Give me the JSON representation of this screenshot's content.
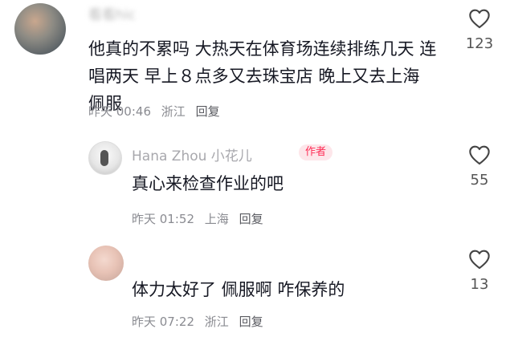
{
  "comments": [
    {
      "username": "看看hic",
      "text": "他真的不累吗 大热天在体育场连续排练几天 连唱两天 早上８点多又去珠宝店 晚上又去上海 佩服",
      "time": "昨天 00:46",
      "location": "浙江",
      "reply": "回复",
      "likes": "123"
    },
    {
      "username": "Hana Zhou 小花儿",
      "badge": "作者",
      "text": "真心来检查作业的吧",
      "time": "昨天 01:52",
      "location": "上海",
      "reply": "回复",
      "likes": "55"
    },
    {
      "text": "体力太好了 佩服啊 咋保养的",
      "time": "昨天 07:22",
      "location": "浙江",
      "reply": "回复",
      "likes": "13"
    }
  ],
  "colors": {
    "accent": "#fe2c55",
    "muted": "#8a8b91",
    "text": "#161823"
  },
  "icons": {
    "like": "heart-outline-icon"
  }
}
